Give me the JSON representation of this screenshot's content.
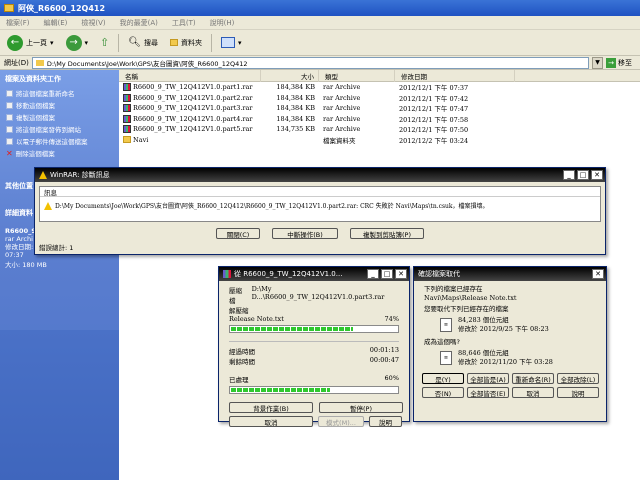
{
  "window": {
    "title": "阿俠_R6600_12Q412"
  },
  "menu": [
    "檔案(F)",
    "編輯(E)",
    "檢視(V)",
    "我的最愛(A)",
    "工具(T)",
    "說明(H)"
  ],
  "toolbar": {
    "back": "上一頁",
    "search": "搜尋",
    "folders": "資料夾"
  },
  "address": {
    "label": "網址(D)",
    "path": "D:\\My Documents\\Joe\\Work\\GPS\\友台圖資\\阿俠_R6600_12Q412",
    "go": "移至"
  },
  "left_pane": {
    "tasks_header": "檔案及資料夾工作",
    "tasks": [
      "將這個檔案重新命名",
      "移動這個檔案",
      "複製這個檔案",
      "將這個檔案發佈到網站",
      "以電子郵件傳送這個檔案",
      "刪除這個檔案"
    ],
    "other_header": "其他位置",
    "details_header": "詳細資料",
    "details_name": "R6600_9_",
    "details_type": "rar Archi",
    "details_modified": "修改日期: 2",
    "details_time": "07:37",
    "details_size": "大小: 180 MB"
  },
  "columns": {
    "name": "名稱",
    "size": "大小",
    "type": "類型",
    "date": "修改日期"
  },
  "files": [
    {
      "name": "R6600_9_TW_12Q412V1.0.part1.rar",
      "size": "184,384 KB",
      "type": "rar Archive",
      "date": "2012/12/1 下午 07:37",
      "icon": "rar-icon"
    },
    {
      "name": "R6600_9_TW_12Q412V1.0.part2.rar",
      "size": "184,384 KB",
      "type": "rar Archive",
      "date": "2012/12/1 下午 07:42",
      "icon": "rar-icon"
    },
    {
      "name": "R6600_9_TW_12Q412V1.0.part3.rar",
      "size": "184,384 KB",
      "type": "rar Archive",
      "date": "2012/12/1 下午 07:47",
      "icon": "rar-icon"
    },
    {
      "name": "R6600_9_TW_12Q412V1.0.part4.rar",
      "size": "184,384 KB",
      "type": "rar Archive",
      "date": "2012/12/1 下午 07:58",
      "icon": "rar-icon"
    },
    {
      "name": "R6600_9_TW_12Q412V1.0.part5.rar",
      "size": "134,735 KB",
      "type": "rar Archive",
      "date": "2012/12/1 下午 07:50",
      "icon": "rar-icon"
    },
    {
      "name": "Navi",
      "size": "",
      "type": "檔案資料夾",
      "date": "2012/12/2 下午 03:24",
      "icon": "folder-icon"
    }
  ],
  "error_dialog": {
    "title": "WinRAR: 診斷訊息",
    "header_label": "訊息",
    "message": "D:\\My Documents\\Joe\\Work\\GPS\\友台圖資\\阿俠_R6600_12Q412\\R6600_9_TW_12Q412V1.0.part2.rar: CRC 失敗於 Navi\\Maps\\tn.csuk，檔案損壞。",
    "btn_close": "關閉(C)",
    "btn_break": "中斷操作(B)",
    "btn_copy": "複製到剪貼簿(P)",
    "total": "錯誤總計: 1"
  },
  "extract_dialog": {
    "title": "從 R6600_9_TW_12Q412V1.0...",
    "extracting_label": "壓縮檔",
    "archive_path": "D:\\My D...\\R6600_9_TW_12Q412V1.0.part3.rar",
    "action_label": "解壓縮",
    "current_file": "Release Note.txt",
    "file_percent": "74%",
    "file_progress": 0.74,
    "elapsed_label": "經過時間",
    "elapsed": "00:01:13",
    "remaining_label": "剩餘時間",
    "remaining": "00:00:47",
    "processed_label": "已處理",
    "processed_percent": "60%",
    "processed_progress": 0.6,
    "btn_background": "背景作業(B)",
    "btn_pause": "暫停(P)",
    "btn_cancel": "取消",
    "btn_mode": "模式(M)...",
    "btn_help": "說明"
  },
  "replace_dialog": {
    "title": "確認檔案取代",
    "line1": "下列的檔案已經存在",
    "line2": "Navi\\Maps\\Release Note.txt",
    "question1": "您要取代下列已經存在的檔案",
    "existing_size": "84,283 個位元組",
    "existing_date": "修改於 2012/9/25 下午 08:23",
    "question2": "成為這個嗎?",
    "new_size": "88,646 個位元組",
    "new_date": "修改於 2012/11/20 下午 03:28",
    "btn_yes": "是(Y)",
    "btn_yes_all": "全部皆是(A)",
    "btn_rename": "重新命名(R)",
    "btn_rename_all": "全部改除(L)",
    "btn_no": "否(N)",
    "btn_no_all": "全部皆否(E)",
    "btn_cancel": "取消",
    "btn_help": "說明"
  }
}
